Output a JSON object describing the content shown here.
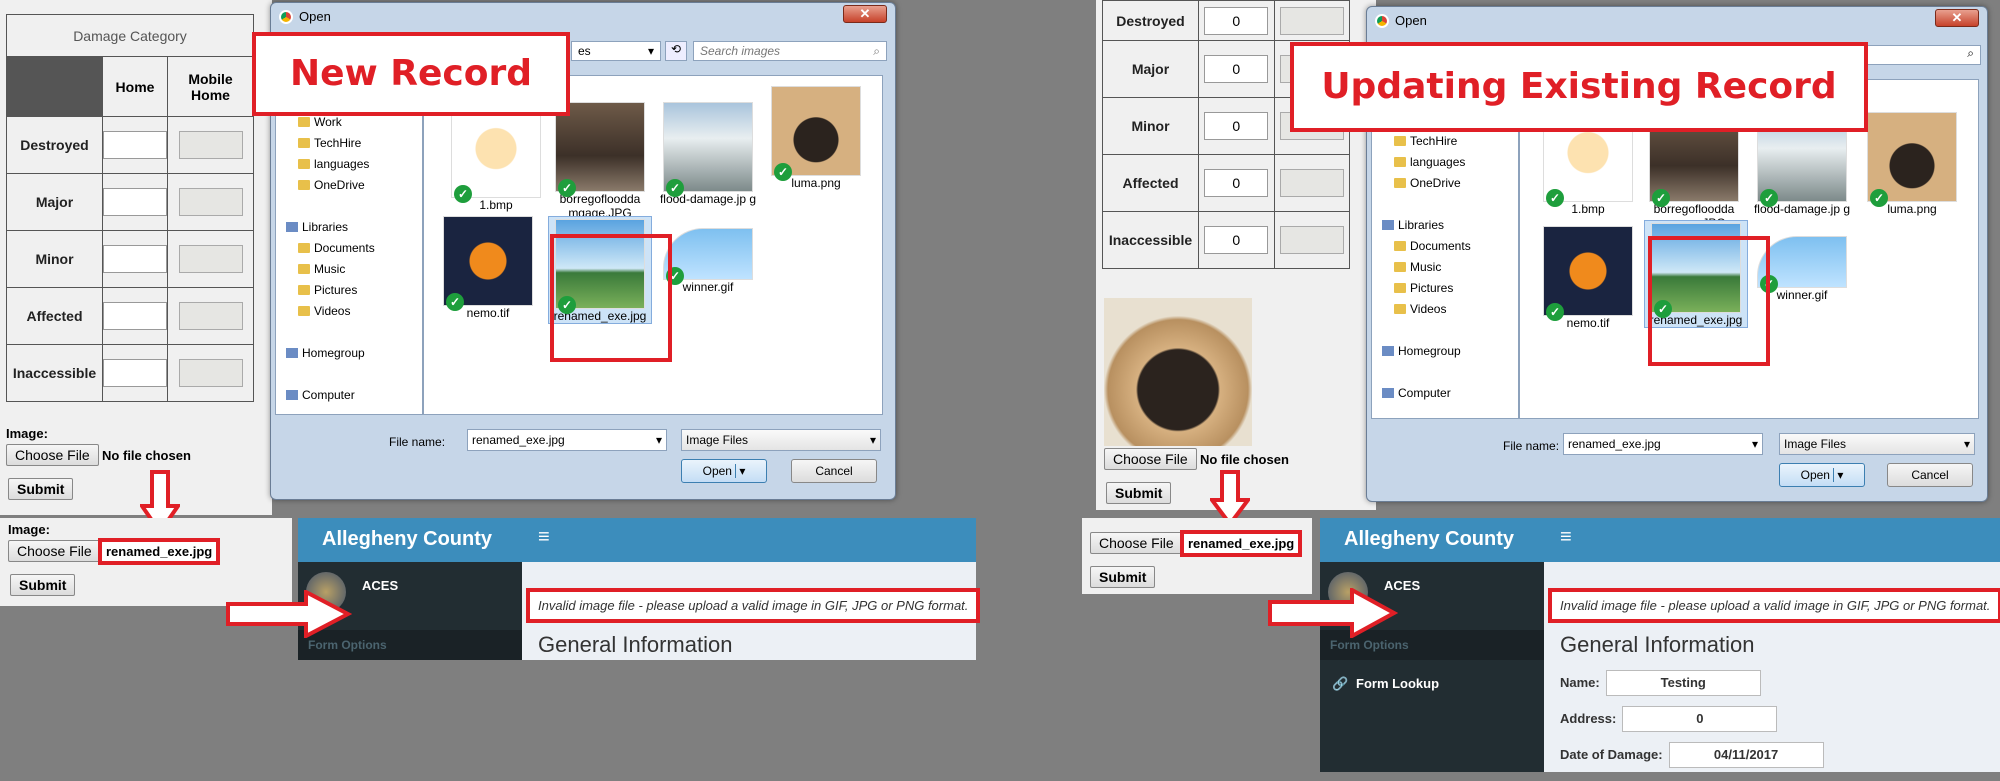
{
  "left": {
    "category_header": "Damage Category",
    "col_home": "Home",
    "col_mobile": "Mobile Home",
    "rows": [
      "Destroyed",
      "Major",
      "Minor",
      "Affected",
      "Inaccessible"
    ],
    "image_label": "Image:",
    "choose_file": "Choose File",
    "no_file": "No file chosen",
    "submit": "Submit",
    "after_image_label": "Image:",
    "after_choose_file": "Choose File",
    "after_filename": "renamed_exe.jpg",
    "after_submit": "Submit",
    "callout": "New Record"
  },
  "right": {
    "rows": [
      "Destroyed",
      "Major",
      "Minor",
      "Affected",
      "Inaccessible"
    ],
    "values": [
      "0",
      "0",
      "0",
      "0",
      "0"
    ],
    "choose_file": "Choose File",
    "no_file": "No file chosen",
    "submit": "Submit",
    "after_choose_file": "Choose File",
    "after_filename": "renamed_exe.jpg",
    "after_submit": "Submit",
    "callout": "Updating Existing Record"
  },
  "dialog": {
    "title": "Open",
    "search_placeholder": "Search images",
    "nav_folders": [
      "Work",
      "TechHire",
      "languages",
      "OneDrive"
    ],
    "libraries": "Libraries",
    "lib_items": [
      "Documents",
      "Music",
      "Pictures",
      "Videos"
    ],
    "homegroup": "Homegroup",
    "computer": "Computer",
    "files": [
      "1.bmp",
      "borregofloodda mgage.JPG",
      "flood-damage.jp g",
      "luma.png",
      "nemo.tif",
      "renamed_exe.jpg",
      "winner.gif"
    ],
    "filename_label": "File name:",
    "filename_value": "renamed_exe.jpg",
    "filter": "Image Files",
    "open": "Open",
    "cancel": "Cancel",
    "left_addr_fragment": "es"
  },
  "aces": {
    "brand": "Allegheny County",
    "menu_icon": "≡",
    "app": "ACES",
    "form_options": "Form Options",
    "form_lookup": "Form Lookup",
    "error": "Invalid image file - please upload a valid image in GIF, JPG or PNG format.",
    "section": "General Information",
    "name_label": "Name:",
    "name_value": "Testing",
    "address_label": "Address:",
    "address_value": "0",
    "date_label": "Date of Damage:",
    "date_value": "04/11/2017"
  },
  "colors": {
    "accent_red": "#e01f26",
    "aces_blue": "#3c8dbc",
    "aces_dark": "#222d32"
  }
}
